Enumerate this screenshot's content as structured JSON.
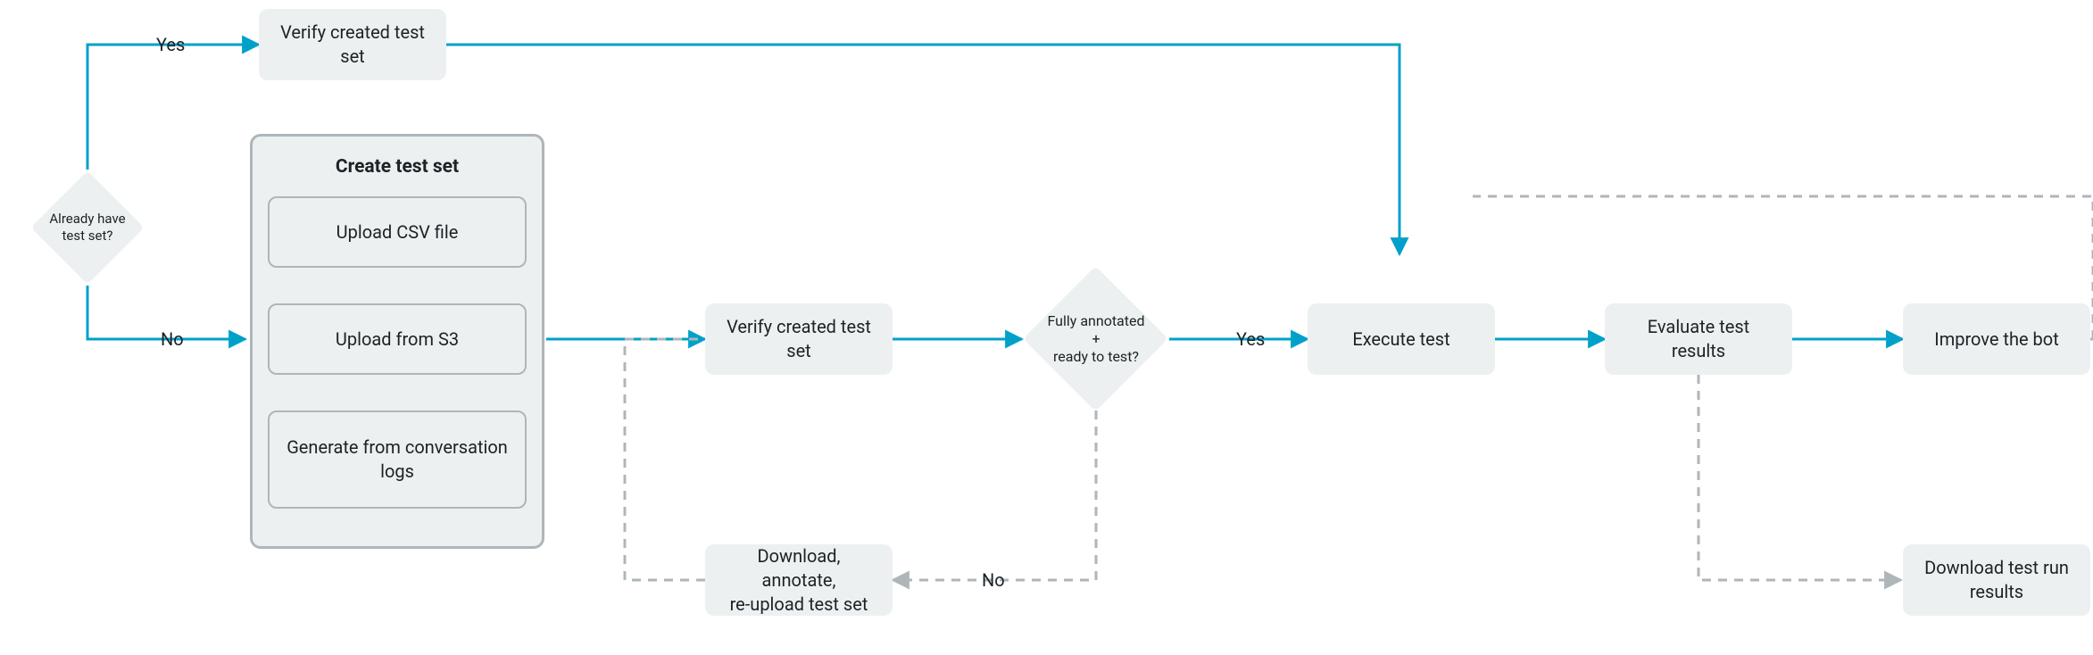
{
  "colors": {
    "teal": "#00a1c9",
    "grey": "#aeb6ba",
    "node_bg": "#edf0f1"
  },
  "decision1": {
    "label": "Already have\ntest set?",
    "yes": "Yes",
    "no": "No"
  },
  "verify_top": "Verify created test\nset",
  "create_group": {
    "title": "Create test set",
    "opt1": "Upload CSV file",
    "opt2": "Upload from S3",
    "opt3": "Generate from conversation\nlogs"
  },
  "verify_mid": "Verify created test\nset",
  "decision2": {
    "label": "Fully annotated\n+\nready to test?",
    "yes": "Yes",
    "no": "No"
  },
  "annotate": "Download, annotate,\nre-upload test set",
  "execute": "Execute test",
  "evaluate": "Evaluate test\nresults",
  "improve": "Improve the bot",
  "download_results": "Download test run\nresults"
}
